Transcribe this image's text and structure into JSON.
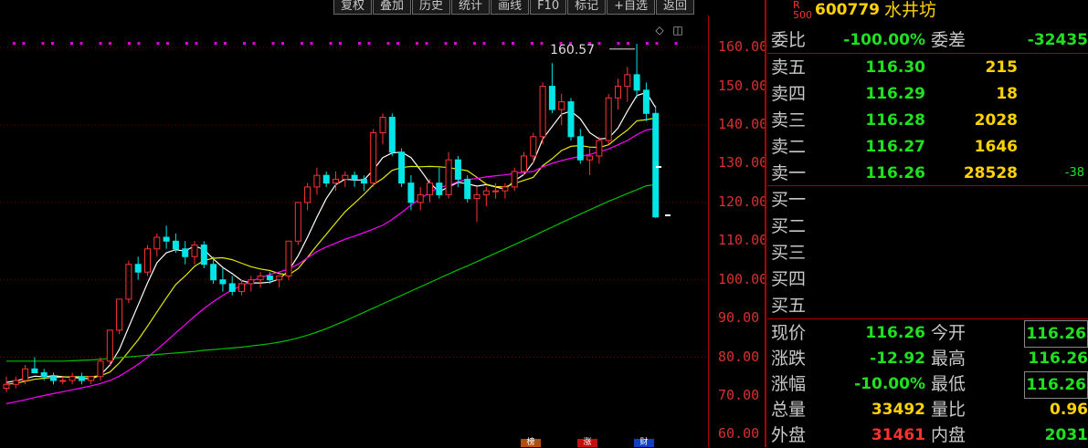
{
  "toolbar": [
    "复权",
    "叠加",
    "历史",
    "统计",
    "画线",
    "F10",
    "标记",
    "+自选",
    "返回"
  ],
  "icons": {
    "diamond": "◇",
    "window": "◫"
  },
  "annotation": "160.57",
  "colors": {
    "up": "#ff3232",
    "down": "#00e5e5",
    "ma5": "#ffffff",
    "ma10": "#e8e800",
    "ma20": "#ff00ff",
    "ma60": "#00c000",
    "axis": "#b00000"
  },
  "y_axis_ticks": [
    "160.00",
    "150.00",
    "140.00",
    "130.00",
    "120.00",
    "110.00",
    "100.00",
    "90.00",
    "80.00",
    "70.00",
    "60.00"
  ],
  "bottom_tags": [
    "榜",
    "涨",
    "财"
  ],
  "chart_data": {
    "type": "candlestick",
    "ylim": [
      57.5,
      169
    ],
    "highlight": {
      "label": "160.57",
      "value": 160.57
    },
    "candles": [
      [
        72,
        75,
        71,
        73
      ],
      [
        73,
        75,
        72,
        74
      ],
      [
        74,
        78,
        73,
        77
      ],
      [
        77,
        80,
        76,
        76
      ],
      [
        76,
        77,
        74,
        75
      ],
      [
        75,
        76,
        73,
        74
      ],
      [
        74,
        75,
        73,
        74
      ],
      [
        74,
        76,
        73,
        75
      ],
      [
        75,
        76,
        73,
        74
      ],
      [
        74,
        75,
        73,
        75
      ],
      [
        75,
        80,
        74,
        79
      ],
      [
        79,
        87,
        78,
        87
      ],
      [
        87,
        95,
        86,
        95
      ],
      [
        95,
        105,
        94,
        104
      ],
      [
        104,
        106,
        100,
        102
      ],
      [
        102,
        109,
        101,
        108
      ],
      [
        108,
        112,
        106,
        111
      ],
      [
        111,
        114,
        108,
        110
      ],
      [
        110,
        112,
        107,
        108
      ],
      [
        108,
        110,
        104,
        106
      ],
      [
        106,
        110,
        104,
        109
      ],
      [
        109,
        110,
        103,
        104
      ],
      [
        104,
        106,
        99,
        100
      ],
      [
        100,
        103,
        97,
        99
      ],
      [
        99,
        101,
        96,
        97
      ],
      [
        97,
        100,
        96,
        99
      ],
      [
        99,
        101,
        97,
        100
      ],
      [
        100,
        102,
        98,
        101
      ],
      [
        101,
        102,
        99,
        100
      ],
      [
        100,
        101,
        98,
        101
      ],
      [
        101,
        110,
        100,
        110
      ],
      [
        110,
        120,
        109,
        120
      ],
      [
        120,
        125,
        118,
        124
      ],
      [
        124,
        129,
        122,
        127
      ],
      [
        127,
        128,
        124,
        125
      ],
      [
        125,
        128,
        123,
        126
      ],
      [
        126,
        128,
        124,
        127
      ],
      [
        127,
        128,
        124,
        126
      ],
      [
        126,
        127,
        123,
        125
      ],
      [
        125,
        139,
        124,
        138
      ],
      [
        138,
        143,
        135,
        142
      ],
      [
        142,
        143,
        132,
        133
      ],
      [
        133,
        134,
        124,
        125
      ],
      [
        125,
        127,
        118,
        120
      ],
      [
        120,
        124,
        118,
        122
      ],
      [
        122,
        126,
        120,
        125
      ],
      [
        125,
        129,
        121,
        122
      ],
      [
        122,
        133,
        121,
        131
      ],
      [
        131,
        132,
        124,
        126
      ],
      [
        126,
        127,
        120,
        121
      ],
      [
        121,
        124,
        115,
        122
      ],
      [
        122,
        124,
        119,
        123
      ],
      [
        123,
        125,
        121,
        123
      ],
      [
        123,
        125,
        121,
        124
      ],
      [
        124,
        129,
        123,
        128
      ],
      [
        128,
        133,
        127,
        132
      ],
      [
        132,
        138,
        130,
        137
      ],
      [
        137,
        151,
        135,
        150
      ],
      [
        150,
        156,
        143,
        144
      ],
      [
        144,
        148,
        140,
        146
      ],
      [
        146,
        147,
        136,
        137
      ],
      [
        137,
        139,
        130,
        131
      ],
      [
        131,
        134,
        127,
        132
      ],
      [
        132,
        137,
        130,
        136
      ],
      [
        136,
        148,
        135,
        147
      ],
      [
        147,
        152,
        144,
        150
      ],
      [
        150,
        155,
        146,
        153
      ],
      [
        153,
        161,
        147,
        149
      ],
      [
        149,
        151,
        141,
        143
      ],
      [
        143,
        145,
        116,
        116.26
      ]
    ],
    "series": [
      {
        "name": "MA5",
        "values": [
          73.5,
          73.9,
          74.5,
          75.1,
          75.0,
          75.2,
          75.0,
          74.8,
          74.6,
          74.4,
          75.4,
          78.0,
          82.0,
          87.8,
          93.5,
          99.2,
          104.4,
          107.0,
          107.8,
          107.4,
          108.8,
          107.8,
          105.4,
          103.2,
          101.6,
          99.8,
          99.2,
          99.2,
          99.4,
          100.2,
          102.4,
          106.2,
          111.0,
          116.2,
          121.0,
          124.6,
          126.0,
          125.8,
          125.8,
          128.4,
          131.6,
          132.8,
          133.0,
          131.6,
          128.4,
          125.0,
          122.8,
          124.0,
          125.2,
          124.8,
          124.2,
          124.6,
          124.0,
          123.4,
          125.6,
          127.2,
          130.4,
          136.4,
          139.6,
          142.8,
          143.6,
          141.6,
          138.0,
          136.4,
          136.6,
          139.2,
          143.6,
          147.6,
          148.4,
          144.5
        ]
      },
      {
        "name": "MA10",
        "values": [
          73.0,
          73.3,
          73.8,
          74.3,
          74.6,
          74.8,
          74.9,
          75.0,
          75.0,
          75.0,
          75.2,
          76.2,
          78.5,
          81.5,
          84.5,
          88.0,
          91.7,
          95.3,
          98.8,
          101.0,
          103.5,
          105.0,
          105.6,
          105.7,
          105.2,
          104.3,
          103.4,
          102.8,
          102.4,
          101.6,
          101.3,
          102.9,
          105.8,
          108.9,
          111.8,
          114.7,
          117.6,
          119.8,
          122.1,
          124.6,
          126.2,
          128.3,
          129.0,
          129.3,
          129.2,
          129.3,
          129.2,
          129.0,
          128.6,
          128.2,
          126.5,
          124.7,
          124.1,
          124.0,
          124.9,
          125.7,
          126.5,
          129.5,
          131.3,
          133.4,
          134.5,
          134.7,
          134.3,
          134.2,
          134.9,
          136.9,
          138.7,
          141.1,
          141.4,
          141.8
        ]
      },
      {
        "name": "MA20",
        "values": [
          68.0,
          68.5,
          69.0,
          69.6,
          70.1,
          70.6,
          71.1,
          71.6,
          72.1,
          72.6,
          73.2,
          74.0,
          75.1,
          76.6,
          78.2,
          80.0,
          82.0,
          84.1,
          86.3,
          88.4,
          90.6,
          92.6,
          94.4,
          96.0,
          97.4,
          98.5,
          99.6,
          100.6,
          101.4,
          102.0,
          102.8,
          104.0,
          105.7,
          107.3,
          108.5,
          109.5,
          110.5,
          111.3,
          112.2,
          113.1,
          114.1,
          115.6,
          117.4,
          119.3,
          121.0,
          122.6,
          123.9,
          124.4,
          125.4,
          125.9,
          126.2,
          126.6,
          126.9,
          127.1,
          127.5,
          127.8,
          128.0,
          129.2,
          130.1,
          130.8,
          131.4,
          131.9,
          132.4,
          133.1,
          133.8,
          134.9,
          136.0,
          137.5,
          138.7,
          139.1
        ]
      },
      {
        "name": "MA60",
        "values": [
          79.0,
          79.0,
          79.0,
          79.0,
          79.0,
          79.0,
          79.0,
          79.1,
          79.2,
          79.3,
          79.5,
          79.7,
          79.9,
          80.1,
          80.3,
          80.5,
          80.7,
          80.9,
          81.1,
          81.3,
          81.5,
          81.8,
          82.0,
          82.2,
          82.4,
          82.6,
          82.9,
          83.2,
          83.5,
          83.9,
          84.4,
          85.0,
          85.7,
          86.5,
          87.4,
          88.4,
          89.4,
          90.5,
          91.6,
          92.7,
          93.8,
          94.9,
          96.0,
          97.1,
          98.2,
          99.3,
          100.4,
          101.5,
          102.6,
          103.6,
          104.7,
          105.8,
          106.9,
          108.0,
          109.1,
          110.2,
          111.3,
          112.5,
          113.6,
          114.8,
          115.9,
          117.0,
          118.1,
          119.2,
          120.3,
          121.3,
          122.3,
          123.3,
          124.3,
          124.6
        ]
      }
    ]
  },
  "quote": {
    "badge": "R\n500",
    "code": "600779",
    "name": "水井坊",
    "weibi": {
      "label": "委比",
      "value": "-100.00%",
      "label2": "委差",
      "value2": "-32435"
    },
    "sells": [
      {
        "label": "卖五",
        "price": "116.30",
        "vol": "215",
        "extra": ""
      },
      {
        "label": "卖四",
        "price": "116.29",
        "vol": "18",
        "extra": ""
      },
      {
        "label": "卖三",
        "price": "116.28",
        "vol": "2028",
        "extra": ""
      },
      {
        "label": "卖二",
        "price": "116.27",
        "vol": "1646",
        "extra": ""
      },
      {
        "label": "卖一",
        "price": "116.26",
        "vol": "28528",
        "extra": "-38"
      }
    ],
    "buys": [
      "买一",
      "买二",
      "买三",
      "买四",
      "买五"
    ],
    "stats": [
      {
        "l1": "现价",
        "v1": "116.26",
        "c1": "#20e020",
        "l2": "今开",
        "v2": "116.26",
        "c2": "#20e020",
        "box": true
      },
      {
        "l1": "涨跌",
        "v1": "-12.92",
        "c1": "#20e020",
        "l2": "最高",
        "v2": "116.26",
        "c2": "#20e020",
        "box": false
      },
      {
        "l1": "涨幅",
        "v1": "-10.00%",
        "c1": "#20e020",
        "l2": "最低",
        "v2": "116.26",
        "c2": "#20e020",
        "box": true
      },
      {
        "l1": "总量",
        "v1": "33492",
        "c1": "#ffd200",
        "l2": "量比",
        "v2": "0.96",
        "c2": "#ffd200",
        "box": false
      },
      {
        "l1": "外盘",
        "v1": "31461",
        "c1": "#ff3030",
        "l2": "内盘",
        "v2": "2031",
        "c2": "#20e020",
        "box": false
      }
    ]
  }
}
